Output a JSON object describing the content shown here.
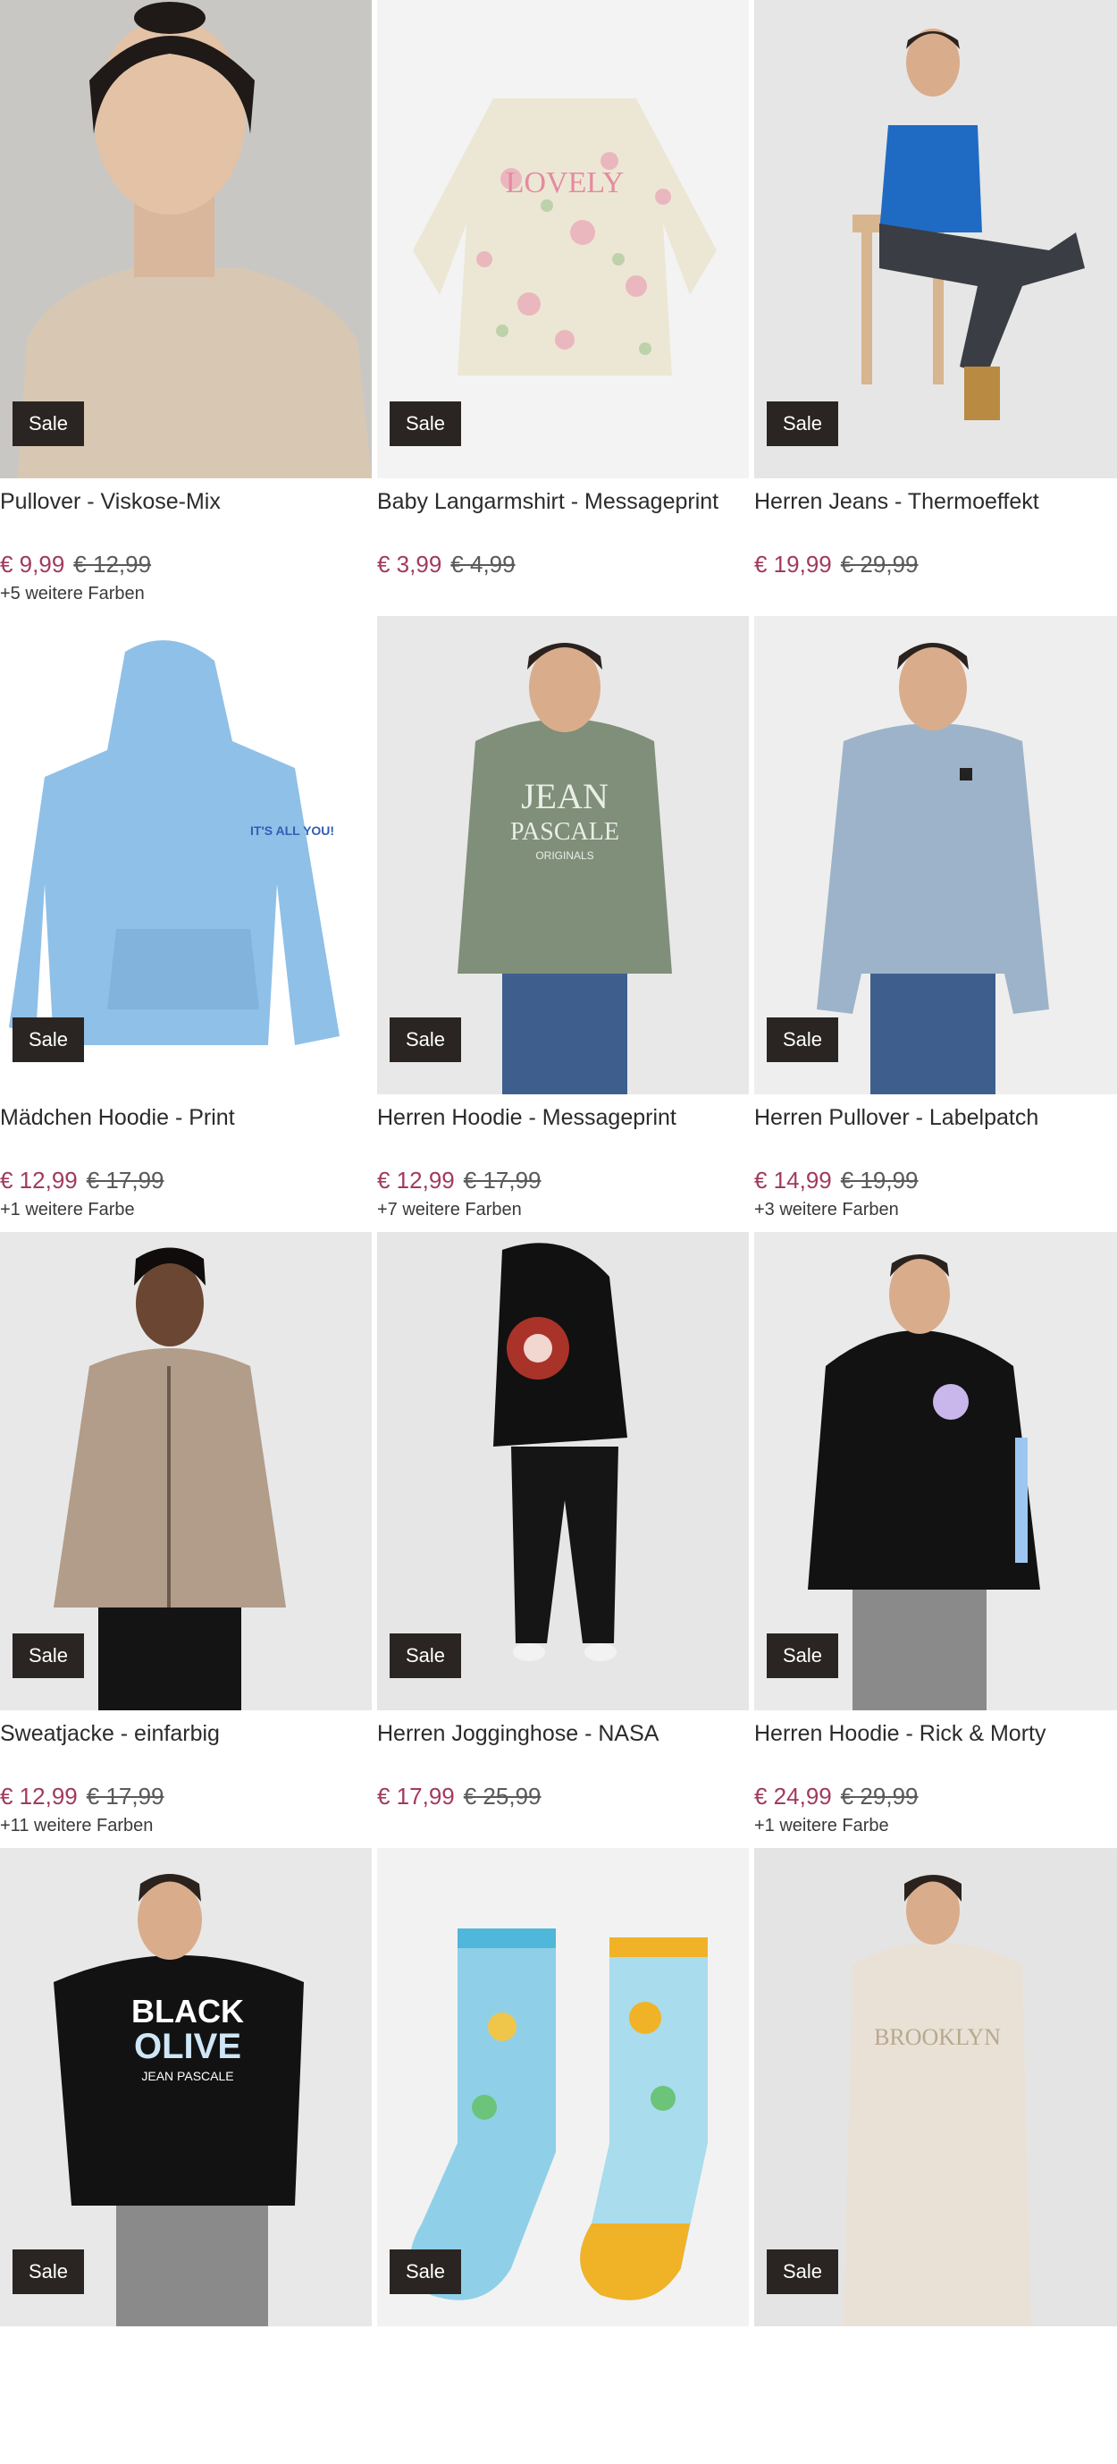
{
  "products": [
    {
      "title": "Pullover - Viskose-Mix",
      "badge": "Sale",
      "price_new": "€ 9,99",
      "price_old": "€ 12,99",
      "colors": "+5 weitere Farben"
    },
    {
      "title": "Baby Langarmshirt - Messageprint",
      "badge": "Sale",
      "price_new": "€ 3,99",
      "price_old": "€ 4,99",
      "colors": ""
    },
    {
      "title": "Herren Jeans - Thermoeffekt",
      "badge": "Sale",
      "price_new": "€ 19,99",
      "price_old": "€ 29,99",
      "colors": ""
    },
    {
      "title": "Mädchen Hoodie - Print",
      "badge": "Sale",
      "price_new": "€ 12,99",
      "price_old": "€ 17,99",
      "colors": "+1 weitere Farbe"
    },
    {
      "title": "Herren Hoodie - Messageprint",
      "badge": "Sale",
      "price_new": "€ 12,99",
      "price_old": "€ 17,99",
      "colors": "+7 weitere Farben"
    },
    {
      "title": "Herren Pullover - Labelpatch",
      "badge": "Sale",
      "price_new": "€ 14,99",
      "price_old": "€ 19,99",
      "colors": "+3 weitere Farben"
    },
    {
      "title": "Sweatjacke - einfarbig",
      "badge": "Sale",
      "price_new": "€ 12,99",
      "price_old": "€ 17,99",
      "colors": "+11 weitere Farben"
    },
    {
      "title": "Herren Jogginghose - NASA",
      "badge": "Sale",
      "price_new": "€ 17,99",
      "price_old": "€ 25,99",
      "colors": ""
    },
    {
      "title": "Herren Hoodie - Rick & Morty",
      "badge": "Sale",
      "price_new": "€ 24,99",
      "price_old": "€ 29,99",
      "colors": "+1 weitere Farbe"
    },
    {
      "title": "",
      "badge": "Sale",
      "price_new": "",
      "price_old": "",
      "colors": ""
    },
    {
      "title": "",
      "badge": "Sale",
      "price_new": "",
      "price_old": "",
      "colors": ""
    },
    {
      "title": "",
      "badge": "Sale",
      "price_new": "",
      "price_old": "",
      "colors": ""
    }
  ],
  "print_text": {
    "lovely": "LOVELY",
    "its_you": "IT'S ALL YOU!",
    "jean": "JEAN",
    "pascale": "PASCALE",
    "originals": "ORIGINALS",
    "black": "BLACK",
    "olive": "OLIVE",
    "jp": "JEAN PASCALE",
    "brooklyn": "BROOKLYN"
  }
}
